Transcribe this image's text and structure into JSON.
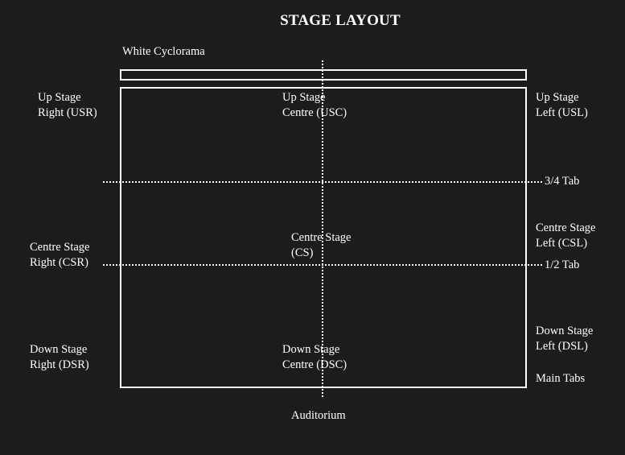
{
  "title": "STAGE LAYOUT",
  "cyclorama_label": "White Cyclorama",
  "areas": {
    "usr": [
      "Up Stage",
      "Right (USR)"
    ],
    "usc": [
      "Up Stage",
      "Centre (USC)"
    ],
    "usl": [
      "Up Stage",
      "Left (USL)"
    ],
    "csr": [
      "Centre Stage",
      "Right (CSR)"
    ],
    "cs": [
      "Centre Stage",
      "(CS)"
    ],
    "csl": [
      "Centre Stage",
      "Left (CSL)"
    ],
    "dsr": [
      "Down Stage",
      "Right (DSR)"
    ],
    "dsc": [
      "Down Stage",
      "Centre (DSC)"
    ],
    "dsl": [
      "Down Stage",
      "Left (DSL)"
    ]
  },
  "tabs": {
    "three_quarter": "3/4 Tab",
    "half": "1/2 Tab",
    "main": "Main Tabs"
  },
  "auditorium_label": "Auditorium"
}
